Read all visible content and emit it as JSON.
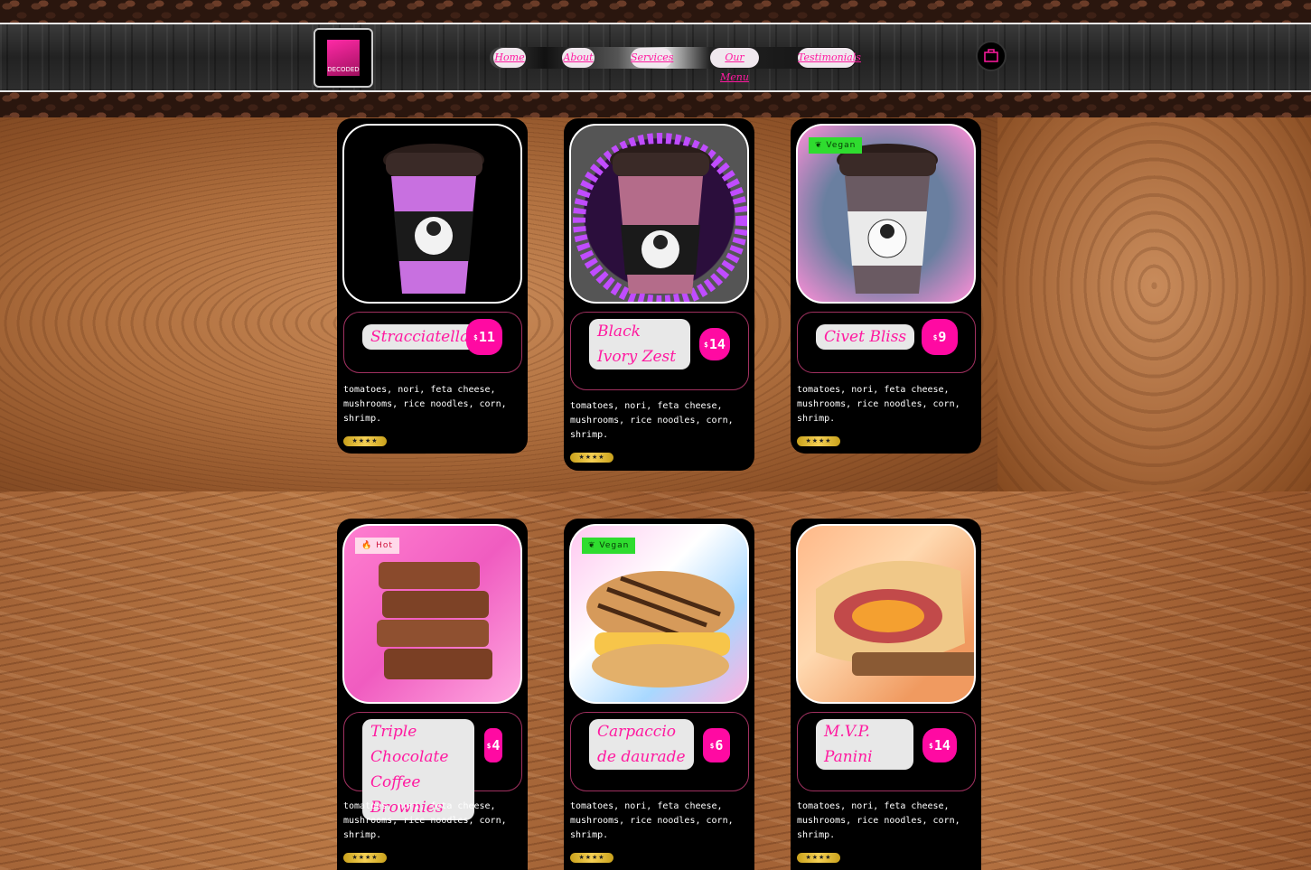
{
  "nav": {
    "items": [
      "Home",
      "About",
      "Services",
      "Our Menu",
      "Testimonials"
    ]
  },
  "brand": {
    "logo_text": "DECODED"
  },
  "colors": {
    "accent": "#ff0aa2",
    "vegan": "#2fdc2f",
    "hot": "#ffd9ea"
  },
  "cards": [
    {
      "name": "Stracciatella",
      "currency": "$",
      "price": "11",
      "badge": "",
      "description": "tomatoes, nori, feta cheese, mushrooms, rice noodles, corn, shrimp.",
      "rating_stars": 4,
      "image": "coffee-cup-purple"
    },
    {
      "name": "Black Ivory Zest",
      "currency": "$",
      "price": "14",
      "badge": "",
      "description": "tomatoes, nori, feta cheese, mushrooms, rice noodles, corn, shrimp.",
      "rating_stars": 4,
      "image": "coffee-cup-pink"
    },
    {
      "name": "Civet Bliss",
      "currency": "$",
      "price": "9",
      "badge": "Vegan",
      "description": "tomatoes, nori, feta cheese, mushrooms, rice noodles, corn, shrimp.",
      "rating_stars": 4,
      "image": "coffee-cup-white"
    },
    {
      "name": "Triple Chocolate Coffee Brownies",
      "currency": "$",
      "price": "4",
      "badge": "Hot",
      "description": "tomatoes, nori, feta cheese, mushrooms, rice noodles, corn, shrimp.",
      "rating_stars": 4,
      "image": "brownies"
    },
    {
      "name": "Carpaccio de daurade",
      "currency": "$",
      "price": "6",
      "badge": "Vegan",
      "description": "tomatoes, nori, feta cheese, mushrooms, rice noodles, corn, shrimp.",
      "rating_stars": 4,
      "image": "panini-sandwich"
    },
    {
      "name": "M.V.P. Panini",
      "currency": "$",
      "price": "14",
      "badge": "",
      "description": "tomatoes, nori, feta cheese, mushrooms, rice noodles, corn, shrimp.",
      "rating_stars": 4,
      "image": "stromboli"
    }
  ],
  "icons": {
    "cart": "shopping-cart-icon",
    "vegan": "leaf-icon",
    "hot": "flame-icon",
    "star": "star-icon"
  }
}
